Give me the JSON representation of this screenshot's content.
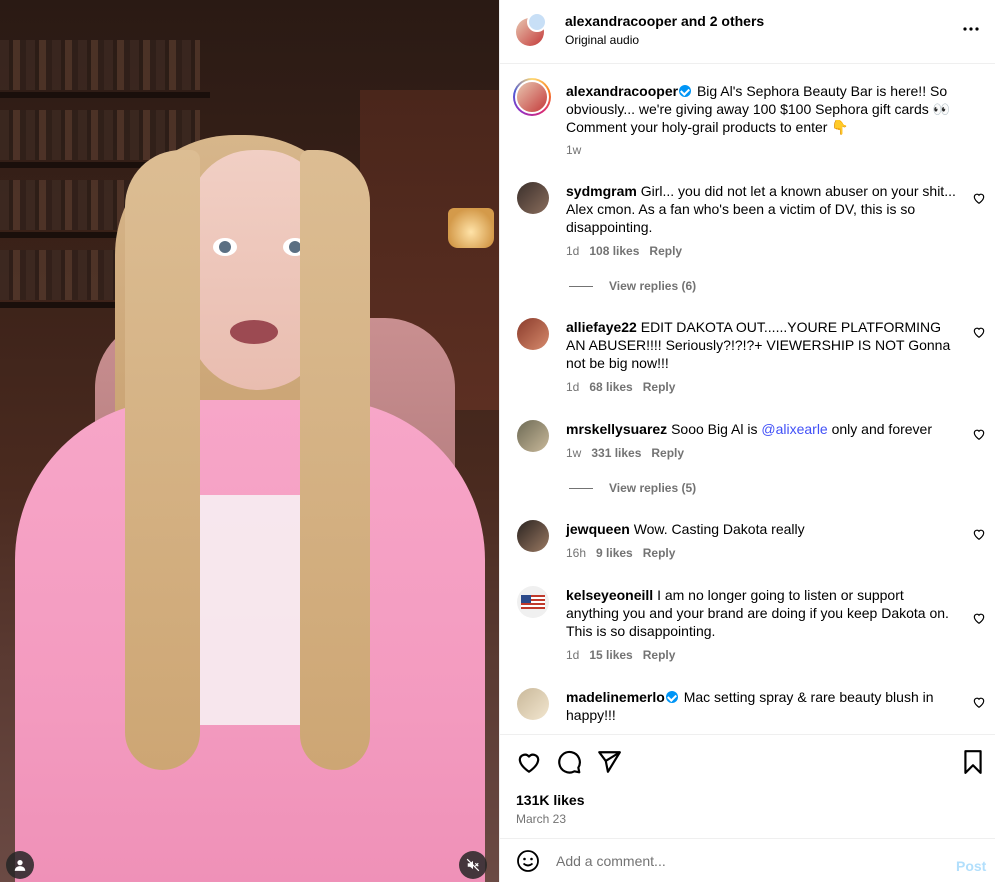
{
  "header": {
    "username": "alexandracooper",
    "and_others": "and 2 others",
    "audio": "Original audio",
    "more_icon": "more-horizontal-icon"
  },
  "caption": {
    "username": "alexandracooper",
    "text": "Big Al's Sephora Beauty Bar is here!! So obviously... we're giving away 100 $100 Sephora gift cards 👀 Comment your holy-grail products to enter 👇",
    "time": "1w"
  },
  "comments": [
    {
      "username": "sydmgram",
      "text": "Girl... you did not let a known abuser on your shit... Alex cmon. As a fan who's been a victim of DV, this is so disappointing.",
      "time": "1d",
      "likes": "108 likes",
      "reply": "Reply",
      "view_replies": "View replies (6)"
    },
    {
      "username": "alliefaye22",
      "text": "EDIT DAKOTA OUT......YOURE PLATFORMING AN ABUSER!!!! Seriously?!?!?+ VIEWERSHIP IS NOT Gonna not be big now!!!",
      "time": "1d",
      "likes": "68 likes",
      "reply": "Reply"
    },
    {
      "username": "mrskellysuarez",
      "text_before": "Sooo Big Al is ",
      "mention": "@alixearle",
      "text_after": " only and forever",
      "time": "1w",
      "likes": "331 likes",
      "reply": "Reply",
      "view_replies": "View replies (5)"
    },
    {
      "username": "jewqueen",
      "text": "Wow. Casting Dakota really",
      "time": "16h",
      "likes": "9 likes",
      "reply": "Reply"
    },
    {
      "username": "kelseyeoneill",
      "text": "I am no longer going to listen or support anything you and your brand are doing if you keep Dakota on. This is so disappointing.",
      "time": "1d",
      "likes": "15 likes",
      "reply": "Reply"
    },
    {
      "username": "madelinemerlo",
      "text": "Mac setting spray & rare beauty blush in happy!!!"
    }
  ],
  "post_info": {
    "likes": "131K likes",
    "date": "March 23"
  },
  "add_comment": {
    "placeholder": "Add a comment...",
    "post_label": "Post"
  },
  "colors": {
    "link": "#00376b",
    "muted": "#737373",
    "verified": "#0095f6",
    "post_disabled": "#b2dffc"
  }
}
